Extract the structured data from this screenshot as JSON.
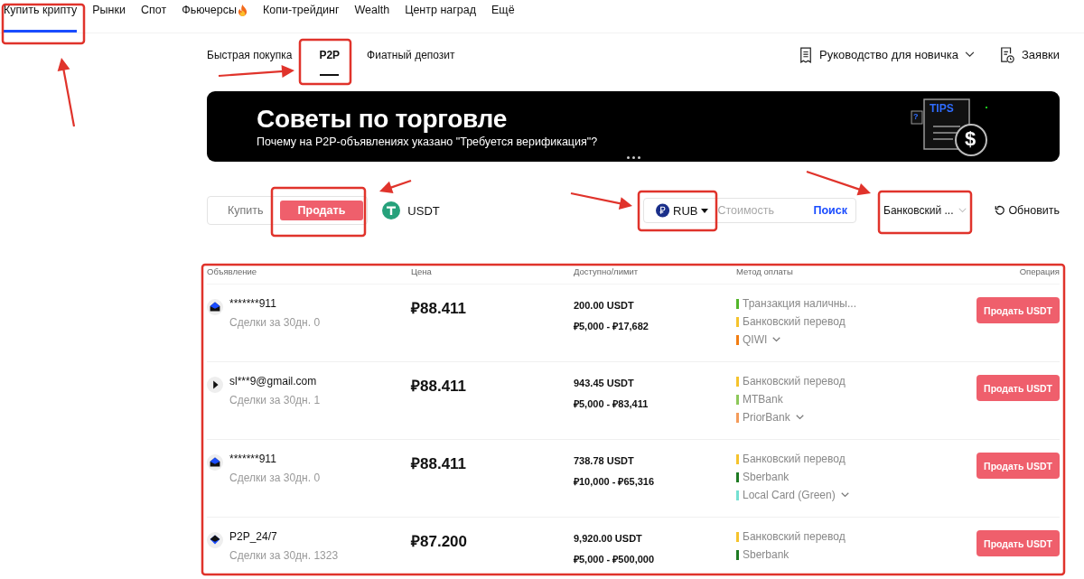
{
  "top_nav": [
    {
      "label": "Купить крипту",
      "selected": true,
      "hot": false
    },
    {
      "label": "Рынки",
      "selected": false,
      "hot": false
    },
    {
      "label": "Спот",
      "selected": false,
      "hot": false
    },
    {
      "label": "Фьючерсы",
      "selected": false,
      "hot": true
    },
    {
      "label": "Копи-трейдинг",
      "selected": false,
      "hot": false
    },
    {
      "label": "Wealth",
      "selected": false,
      "hot": false
    },
    {
      "label": "Центр наград",
      "selected": false,
      "hot": false
    },
    {
      "label": "Ещё",
      "selected": false,
      "hot": false
    }
  ],
  "sub_tabs": [
    {
      "label": "Быстрая покупка",
      "selected": false
    },
    {
      "label": "P2P",
      "selected": true
    },
    {
      "label": "Фиатный депозит",
      "selected": false
    }
  ],
  "guide": {
    "label": "Руководство для новичка"
  },
  "orders_link": {
    "label": "Заявки"
  },
  "banner": {
    "title": "Советы по торговле",
    "subtitle": "Почему на P2P-объявлениях указано \"Требуется верификация\"?",
    "illustration": {
      "label": "TIPS",
      "marks": [
        "?",
        "$"
      ]
    }
  },
  "side_toggle": [
    {
      "label": "Купить",
      "selected": false
    },
    {
      "label": "Продать",
      "selected": true
    }
  ],
  "asset": {
    "label": "USDT"
  },
  "currency": {
    "code": "RUB",
    "placeholder": "Стоимость",
    "search": "Поиск"
  },
  "payment_filter": {
    "value": "Банковский ..."
  },
  "refresh": {
    "label": "Обновить"
  },
  "table": {
    "columns": [
      "Объявление",
      "Цена",
      "Доступно/лимит",
      "Метод оплаты",
      "Операция"
    ],
    "rows": [
      {
        "kind": "mail",
        "name": "*******911",
        "deals": "Сделки за 30дн. 0",
        "price": "₽88.411",
        "available": "200.00 USDT",
        "limit": "₽5,000 - ₽17,682",
        "methods": [
          {
            "label": "Транзакция наличны...",
            "color": "#52b52a",
            "expandable": false
          },
          {
            "label": "Банковский перевод",
            "color": "#f5c32c",
            "expandable": false
          },
          {
            "label": "QIWI",
            "color": "#f27d12",
            "expandable": true
          }
        ],
        "action": "Продать USDT"
      },
      {
        "kind": "crescent",
        "name": "sl***9@gmail.com",
        "deals": "Сделки за 30дн. 1",
        "price": "₽88.411",
        "available": "943.45 USDT",
        "limit": "₽5,000 - ₽83,411",
        "methods": [
          {
            "label": "Банковский перевод",
            "color": "#f5c32c",
            "expandable": false
          },
          {
            "label": "MTBank",
            "color": "#8dc85a",
            "expandable": false
          },
          {
            "label": "PriorBank",
            "color": "#f49b5a",
            "expandable": true
          }
        ],
        "action": "Продать USDT"
      },
      {
        "kind": "mail",
        "name": "*******911",
        "deals": "Сделки за 30дн. 0",
        "price": "₽88.411",
        "available": "738.78 USDT",
        "limit": "₽10,000 - ₽65,316",
        "methods": [
          {
            "label": "Банковский перевод",
            "color": "#f5c32c",
            "expandable": false
          },
          {
            "label": "Sberbank",
            "color": "#1e7a22",
            "expandable": false
          },
          {
            "label": "Local Card (Green)",
            "color": "#74e0d2",
            "expandable": true
          }
        ],
        "action": "Продать USDT"
      },
      {
        "kind": "diamond",
        "name": "P2P_24/7",
        "deals": "Сделки за 30дн. 1323",
        "price": "₽87.200",
        "available": "9,920.00 USDT",
        "limit": "₽5,000 - ₽500,000",
        "methods": [
          {
            "label": "Банковский перевод",
            "color": "#f5c32c",
            "expandable": false
          },
          {
            "label": "Sberbank",
            "color": "#1e7a22",
            "expandable": false
          }
        ],
        "action": "Продать USDT"
      }
    ]
  }
}
